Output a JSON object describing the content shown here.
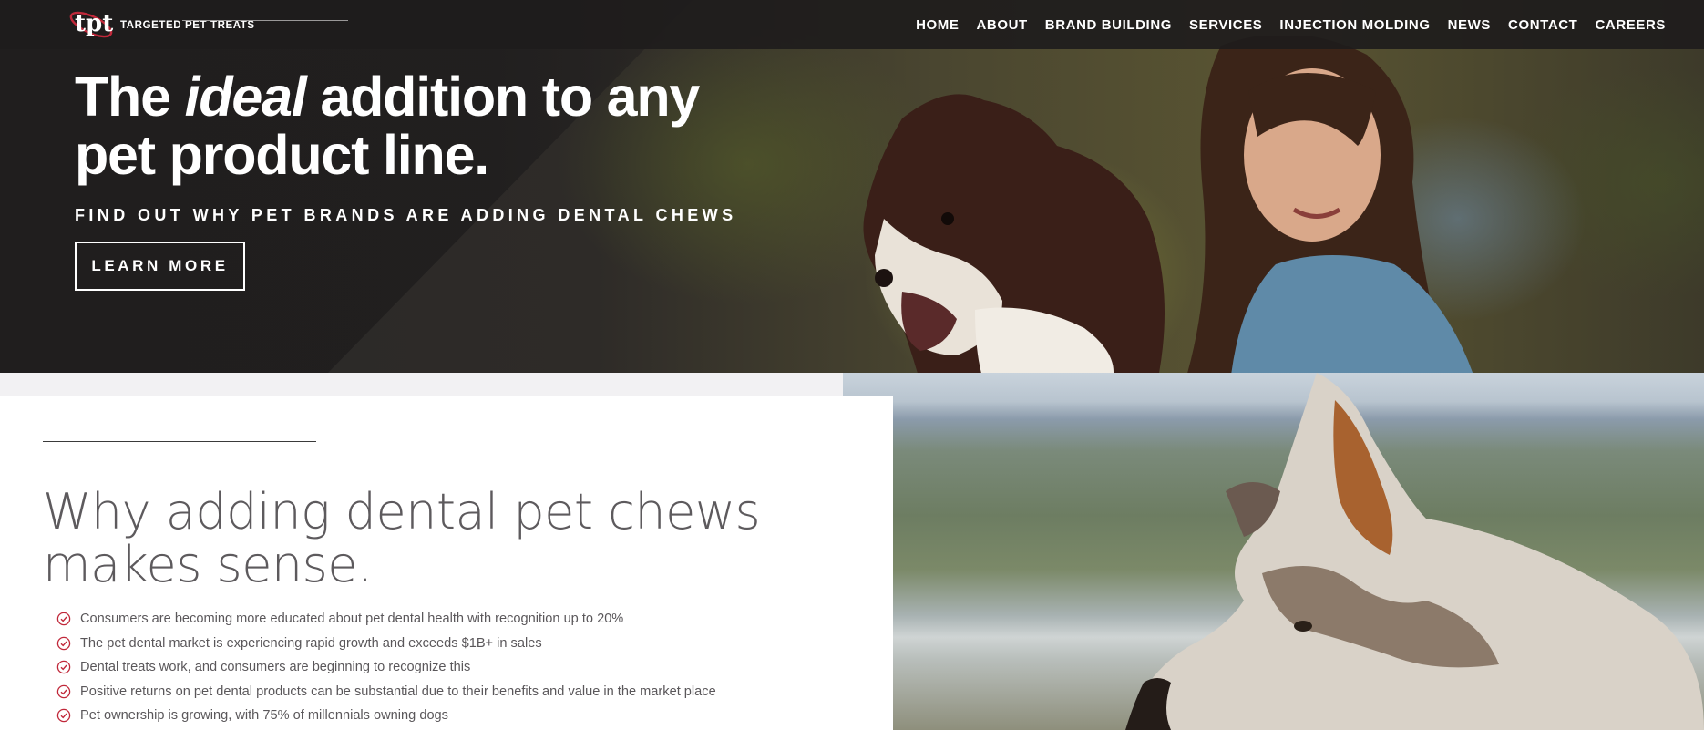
{
  "brand": {
    "logo_text": "TARGETED PET TREATS",
    "accent_color": "#c0283a"
  },
  "nav": {
    "items": [
      {
        "label": "HOME"
      },
      {
        "label": "ABOUT"
      },
      {
        "label": "BRAND BUILDING"
      },
      {
        "label": "SERVICES"
      },
      {
        "label": "INJECTION MOLDING"
      },
      {
        "label": "NEWS"
      },
      {
        "label": "CONTACT"
      },
      {
        "label": "CAREERS"
      }
    ]
  },
  "hero": {
    "title_part1": "The ",
    "title_italic": "ideal",
    "title_part2": " addition to any pet product line.",
    "subtitle": "FIND OUT WHY PET BRANDS ARE ADDING DENTAL CHEWS",
    "cta_label": "LEARN MORE"
  },
  "section": {
    "title": "Why adding dental pet chews makes sense.",
    "check_icon": "circle-check-icon",
    "benefits": [
      "Consumers are becoming more educated about pet dental health with recognition up to 20%",
      "The pet dental market is experiencing rapid growth and exceeds $1B+ in sales",
      "Dental treats work, and consumers are beginning to recognize this",
      "Positive returns on pet dental products can be substantial due to their benefits and value in the market place",
      "Pet ownership is growing, with 75% of millennials owning dogs"
    ]
  }
}
